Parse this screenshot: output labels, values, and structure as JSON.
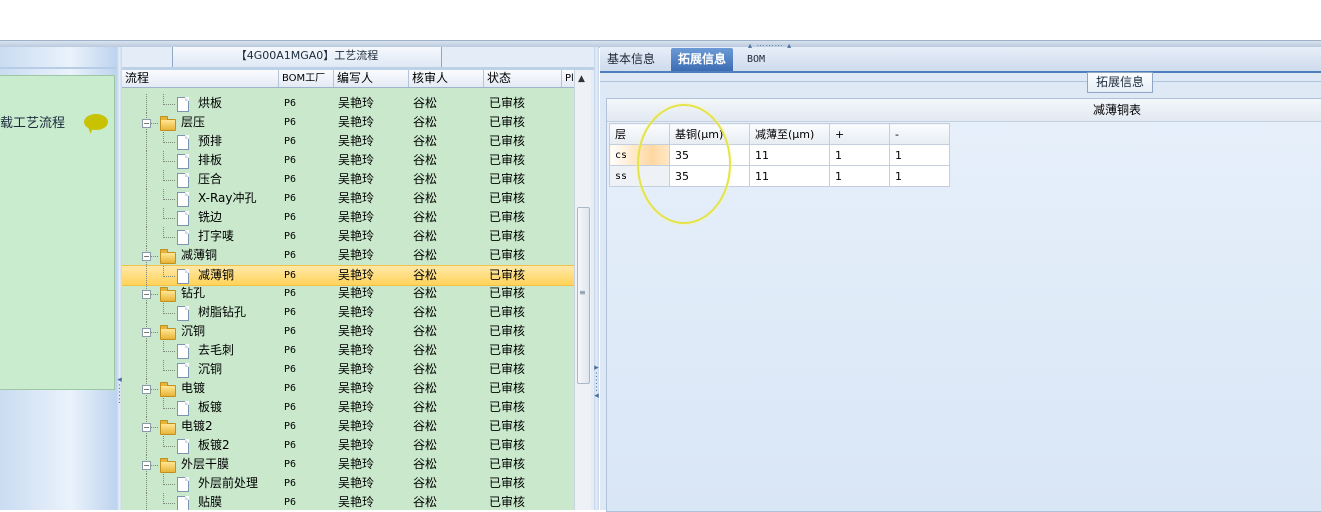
{
  "left_panel": {
    "title": "载工艺流程"
  },
  "center": {
    "caption": "【4G00A1MGA0】工艺流程",
    "columns": [
      "流程",
      "BOM工厂",
      "编写人",
      "核审人",
      "状态",
      "Pl"
    ],
    "rows": [
      {
        "name": "烘板",
        "kind": "doc",
        "bom": "P6",
        "writer": "吴艳玲",
        "reviewer": "谷松",
        "status": "已审核"
      },
      {
        "name": "层压",
        "kind": "folder",
        "bom": "P6",
        "writer": "吴艳玲",
        "reviewer": "谷松",
        "status": "已审核"
      },
      {
        "name": "预排",
        "kind": "doc",
        "bom": "P6",
        "writer": "吴艳玲",
        "reviewer": "谷松",
        "status": "已审核"
      },
      {
        "name": "排板",
        "kind": "doc",
        "bom": "P6",
        "writer": "吴艳玲",
        "reviewer": "谷松",
        "status": "已审核"
      },
      {
        "name": "压合",
        "kind": "doc",
        "bom": "P6",
        "writer": "吴艳玲",
        "reviewer": "谷松",
        "status": "已审核"
      },
      {
        "name": "X-Ray冲孔",
        "kind": "doc",
        "bom": "P6",
        "writer": "吴艳玲",
        "reviewer": "谷松",
        "status": "已审核"
      },
      {
        "name": "铣边",
        "kind": "doc",
        "bom": "P6",
        "writer": "吴艳玲",
        "reviewer": "谷松",
        "status": "已审核"
      },
      {
        "name": "打字唛",
        "kind": "doc",
        "bom": "P6",
        "writer": "吴艳玲",
        "reviewer": "谷松",
        "status": "已审核"
      },
      {
        "name": "减薄铜",
        "kind": "folder",
        "bom": "P6",
        "writer": "吴艳玲",
        "reviewer": "谷松",
        "status": "已审核"
      },
      {
        "name": "减薄铜",
        "kind": "doc",
        "selected": true,
        "bom": "P6",
        "writer": "吴艳玲",
        "reviewer": "谷松",
        "status": "已审核"
      },
      {
        "name": "钻孔",
        "kind": "folder",
        "bom": "P6",
        "writer": "吴艳玲",
        "reviewer": "谷松",
        "status": "已审核"
      },
      {
        "name": "树脂钻孔",
        "kind": "doc",
        "bom": "P6",
        "writer": "吴艳玲",
        "reviewer": "谷松",
        "status": "已审核"
      },
      {
        "name": "沉铜",
        "kind": "folder",
        "bom": "P6",
        "writer": "吴艳玲",
        "reviewer": "谷松",
        "status": "已审核"
      },
      {
        "name": "去毛刺",
        "kind": "doc",
        "bom": "P6",
        "writer": "吴艳玲",
        "reviewer": "谷松",
        "status": "已审核"
      },
      {
        "name": "沉铜",
        "kind": "doc",
        "bom": "P6",
        "writer": "吴艳玲",
        "reviewer": "谷松",
        "status": "已审核"
      },
      {
        "name": "电镀",
        "kind": "folder",
        "bom": "P6",
        "writer": "吴艳玲",
        "reviewer": "谷松",
        "status": "已审核"
      },
      {
        "name": "板镀",
        "kind": "doc",
        "bom": "P6",
        "writer": "吴艳玲",
        "reviewer": "谷松",
        "status": "已审核"
      },
      {
        "name": "电镀2",
        "kind": "folder",
        "bom": "P6",
        "writer": "吴艳玲",
        "reviewer": "谷松",
        "status": "已审核"
      },
      {
        "name": "板镀2",
        "kind": "doc",
        "bom": "P6",
        "writer": "吴艳玲",
        "reviewer": "谷松",
        "status": "已审核"
      },
      {
        "name": "外层干膜",
        "kind": "folder",
        "bom": "P6",
        "writer": "吴艳玲",
        "reviewer": "谷松",
        "status": "已审核"
      },
      {
        "name": "外层前处理",
        "kind": "doc",
        "bom": "P6",
        "writer": "吴艳玲",
        "reviewer": "谷松",
        "status": "已审核"
      },
      {
        "name": "贴膜",
        "kind": "doc",
        "bom": "P6",
        "writer": "吴艳玲",
        "reviewer": "谷松",
        "status": "已审核"
      }
    ]
  },
  "right": {
    "tabs": [
      "基本信息",
      "拓展信息",
      "BOM"
    ],
    "active_tab": "拓展信息",
    "section_caption": "拓展信息",
    "table_title": "减薄铜表",
    "headers": [
      "层",
      "基铜(μm)",
      "减薄至(μm)",
      "+",
      "-"
    ],
    "rows": [
      [
        "cs",
        "35",
        "11",
        "1",
        "1"
      ],
      [
        "ss",
        "35",
        "11",
        "1",
        "1"
      ]
    ]
  }
}
